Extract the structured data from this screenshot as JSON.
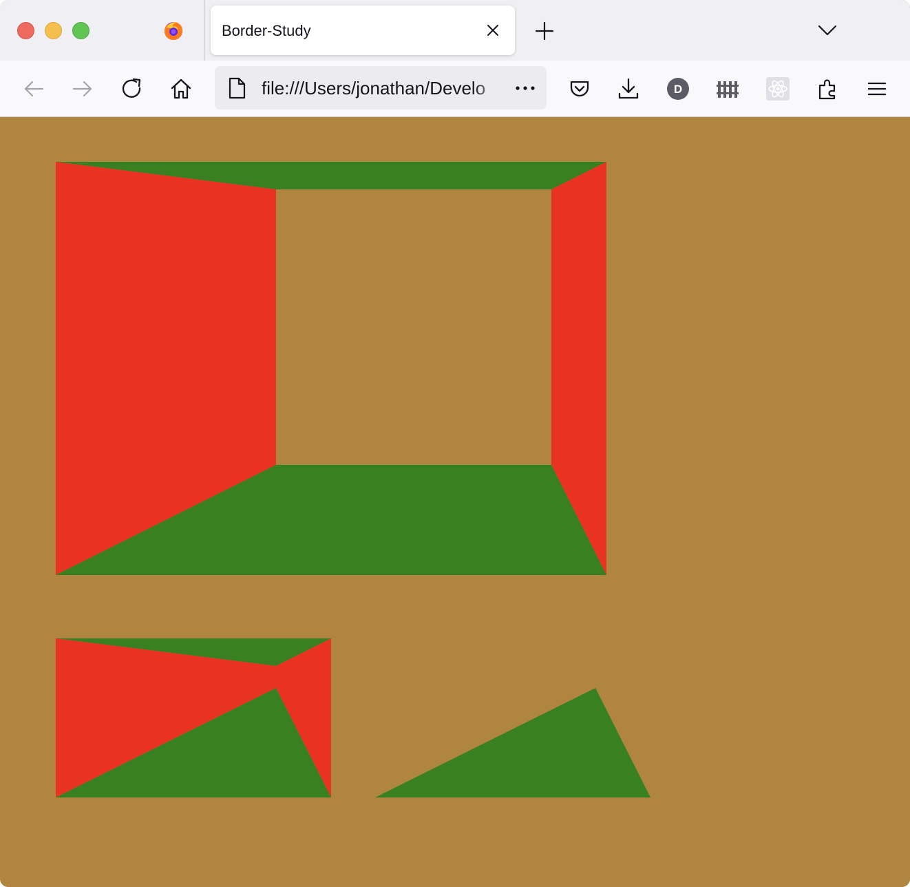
{
  "window": {
    "tab": {
      "title": "Border-Study"
    },
    "urlbar": {
      "url": "file:///Users/jonathan/Develo"
    }
  },
  "colors": {
    "page_background": "#b08540",
    "border_red": "#e83323",
    "border_green": "#388021"
  },
  "icons": {
    "traffic": [
      "close-window",
      "minimize-window",
      "zoom-window"
    ],
    "toolbar": [
      "back-arrow-icon",
      "forward-arrow-icon",
      "reload-icon",
      "home-icon",
      "page-document-icon",
      "more-dots-icon",
      "pocket-icon",
      "download-icon",
      "extension-d-icon",
      "fence-extension-icon",
      "react-devtools-icon",
      "extensions-puzzle-icon",
      "hamburger-menu-icon"
    ]
  }
}
